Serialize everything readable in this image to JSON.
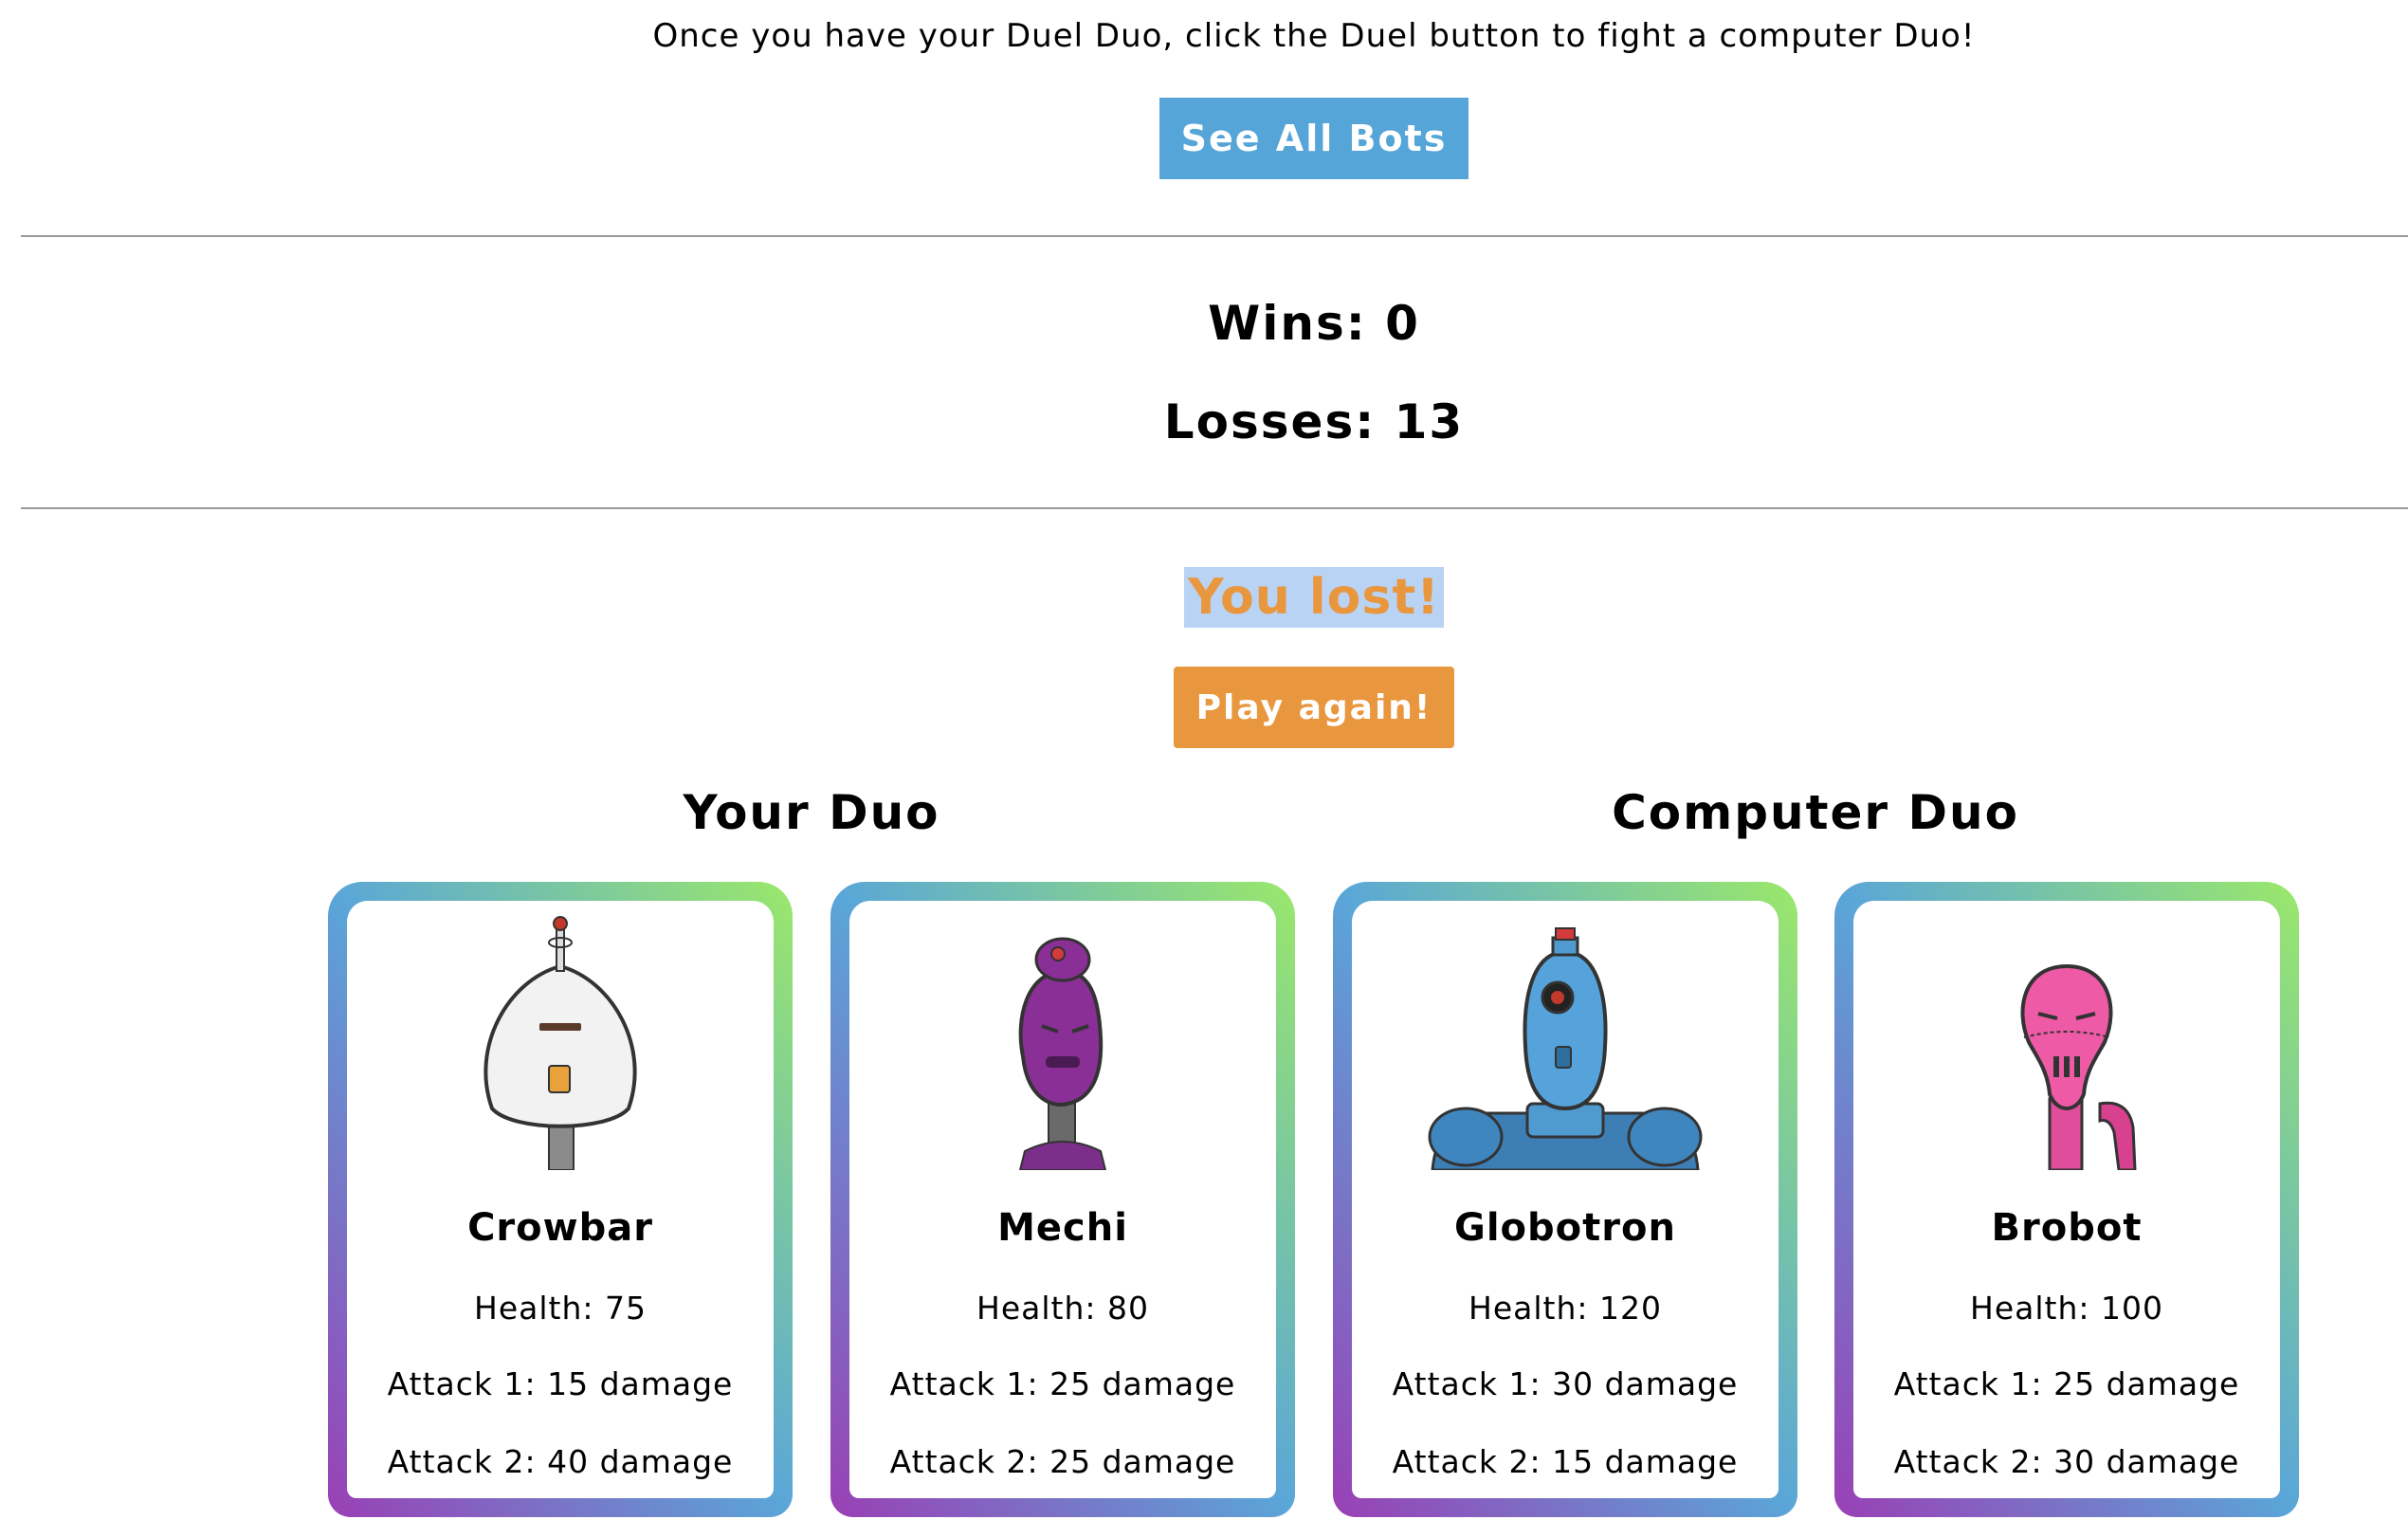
{
  "intro_text": "Once you have your Duel Duo, click the Duel button to fight a computer Duo!",
  "see_all_label": "See All Bots",
  "wins_label": "Wins: 0",
  "losses_label": "Losses: 13",
  "result_text": "You lost!",
  "play_again_label": "Play again!",
  "your_duo_title": "Your Duo",
  "computer_duo_title": "Computer Duo",
  "colors": {
    "blue_button": "#56a5d8",
    "orange_accent": "#e9973f",
    "highlight": "#b9d3f5"
  },
  "your_duo": [
    {
      "name": "Crowbar",
      "health": "Health: 75",
      "attack1": "Attack 1: 15 damage",
      "attack2": "Attack 2: 40 damage"
    },
    {
      "name": "Mechi",
      "health": "Health: 80",
      "attack1": "Attack 1: 25 damage",
      "attack2": "Attack 2: 25 damage"
    }
  ],
  "computer_duo": [
    {
      "name": "Globotron",
      "health": "Health: 120",
      "attack1": "Attack 1: 30 damage",
      "attack2": "Attack 2: 15 damage"
    },
    {
      "name": "Brobot",
      "health": "Health: 100",
      "attack1": "Attack 1: 25 damage",
      "attack2": "Attack 2: 30 damage"
    }
  ]
}
